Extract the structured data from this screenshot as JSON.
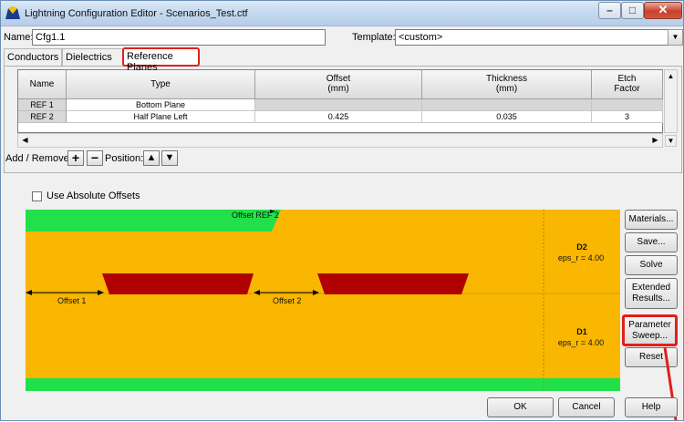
{
  "window": {
    "title": "Lightning Configuration Editor - Scenarios_Test.ctf"
  },
  "name_field": {
    "label": "Name:",
    "value": "Cfg1.1"
  },
  "template_field": {
    "label": "Template:",
    "value": "<custom>"
  },
  "tabs": [
    {
      "label": "Conductors"
    },
    {
      "label": "Dielectrics"
    },
    {
      "label": "Reference Planes",
      "active": true
    }
  ],
  "grid": {
    "headers": [
      "Name",
      "Type",
      "Offset\n(mm)",
      "Thickness\n(mm)",
      "Etch\nFactor"
    ],
    "header_lines": [
      [
        "Name"
      ],
      [
        "Type"
      ],
      [
        "Offset",
        "(mm)"
      ],
      [
        "Thickness",
        "(mm)"
      ],
      [
        "Etch",
        "Factor"
      ]
    ],
    "rows": [
      {
        "name": "REF 1",
        "type": "Bottom Plane",
        "offset": "",
        "thickness": "",
        "etch": ""
      },
      {
        "name": "REF 2",
        "type": "Half Plane Left",
        "offset": "0.425",
        "thickness": "0.035",
        "etch": "3"
      }
    ]
  },
  "add_remove": {
    "label": "Add / Remove:",
    "position_label": "Position:"
  },
  "use_absolute_offsets": {
    "label": "Use Absolute Offsets",
    "checked": false
  },
  "canvas": {
    "offset_ref2": "Offset REF 2",
    "offset1": "Offset 1",
    "offset2": "Offset 2",
    "layers": [
      {
        "name": "D2",
        "eps": "eps_r = 4.00"
      },
      {
        "name": "D1",
        "eps": "eps_r = 4.00"
      }
    ],
    "colors": {
      "dielectric": "#f9b702",
      "plane": "#22e04a",
      "conductor": "#b00000"
    }
  },
  "side_buttons": {
    "materials": "Materials...",
    "save": "Save...",
    "solve": "Solve",
    "extended_1": "Extended",
    "extended_2": "Results...",
    "param_1": "Parameter",
    "param_2": "Sweep...",
    "reset": "Reset"
  },
  "bottom_buttons": {
    "ok": "OK",
    "cancel": "Cancel",
    "help": "Help"
  },
  "highlight_color": "#e0201c"
}
